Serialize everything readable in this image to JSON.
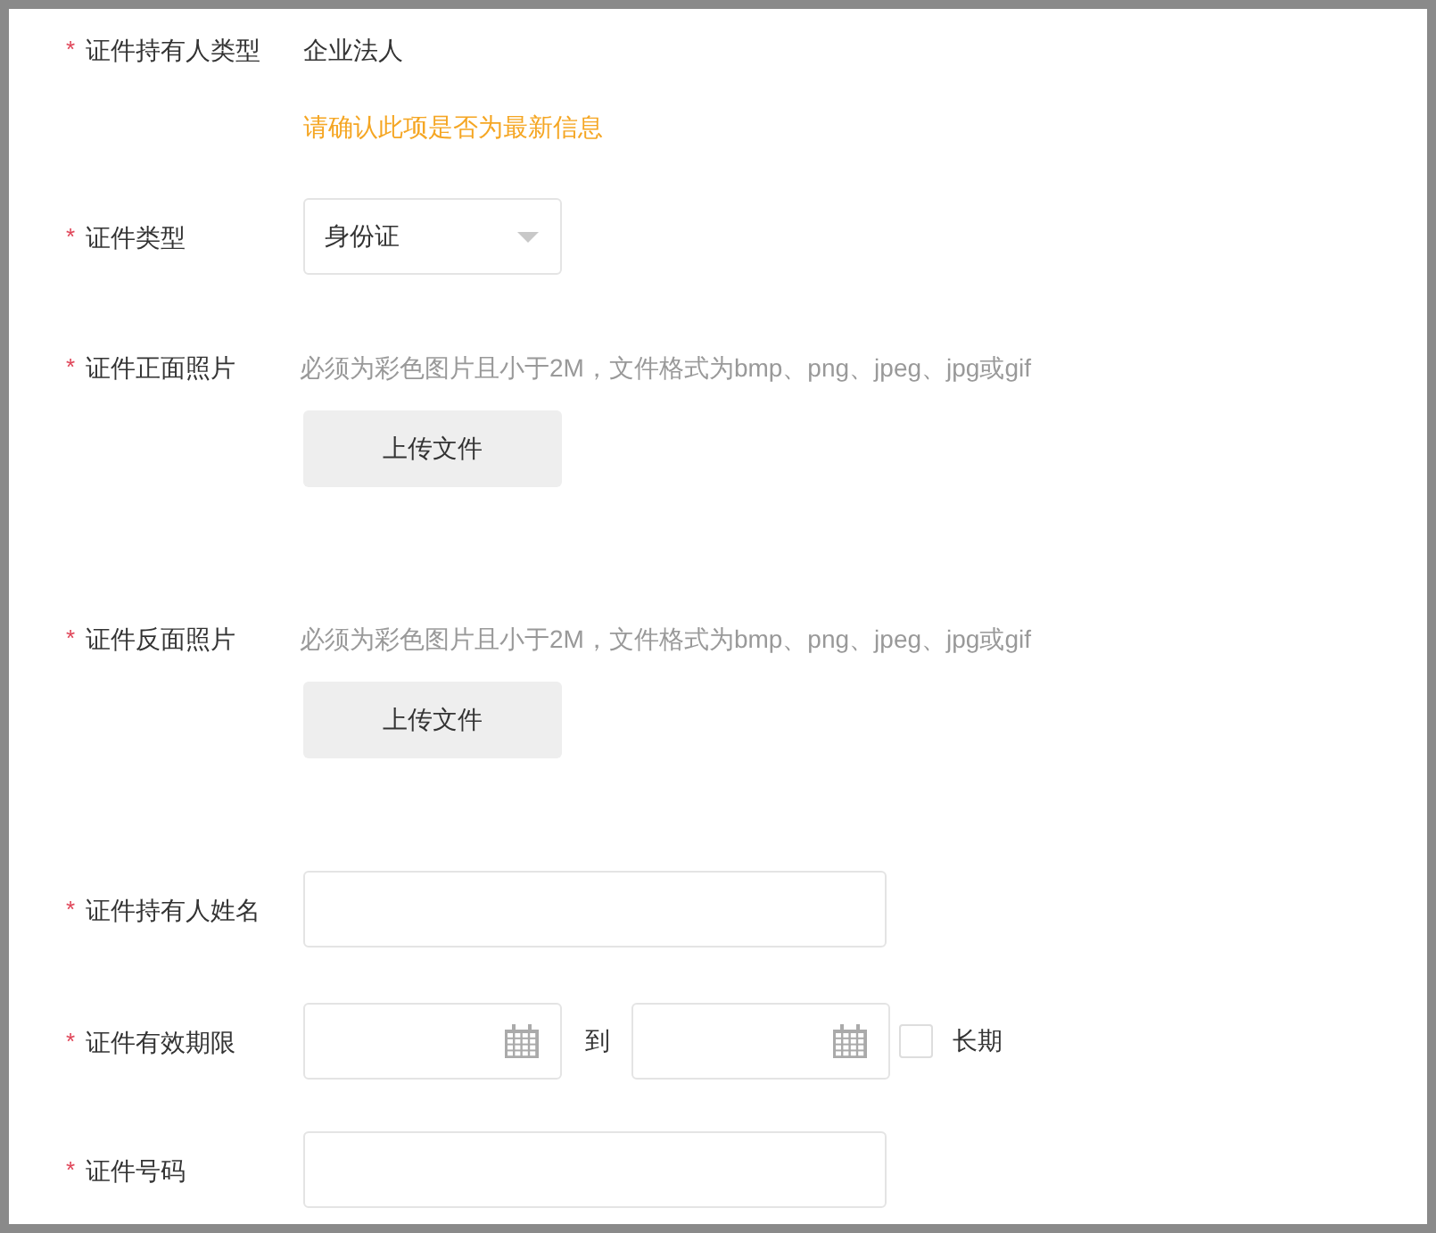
{
  "fields": [
    {
      "kind": "static",
      "asterisk": "*",
      "label": "证件持有人类型",
      "value": "企业法人",
      "notice": "请确认此项是否为最新信息"
    },
    {
      "kind": "select",
      "asterisk": "*",
      "label": "证件类型",
      "value": "身份证"
    },
    {
      "kind": "upload",
      "asterisk": "*",
      "label": "证件正面照片",
      "hint": "必须为彩色图片且小于2M，文件格式为bmp、png、jpeg、jpg或gif",
      "button": "上传文件"
    },
    {
      "kind": "upload",
      "asterisk": "*",
      "label": "证件反面照片",
      "hint": "必须为彩色图片且小于2M，文件格式为bmp、png、jpeg、jpg或gif",
      "button": "上传文件"
    },
    {
      "kind": "input",
      "asterisk": "*",
      "label": "证件持有人姓名"
    },
    {
      "kind": "date_range",
      "asterisk": "*",
      "label": "证件有效期限",
      "separator": "到",
      "checkbox_label": "长期",
      "checked": false
    },
    {
      "kind": "input",
      "asterisk": "*",
      "label": "证件号码"
    }
  ]
}
